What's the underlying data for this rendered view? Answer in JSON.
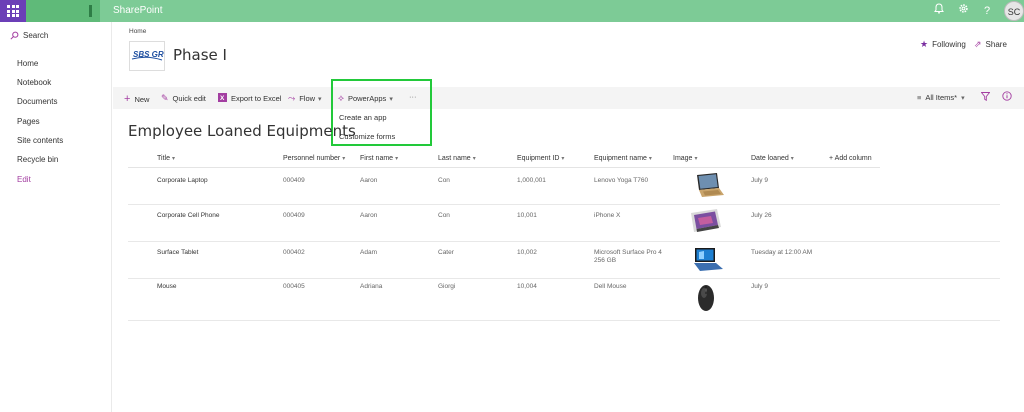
{
  "suite": {
    "title": "SharePoint",
    "avatar_initials": "SC"
  },
  "leftnav": {
    "search_label": "Search",
    "items": [
      "Home",
      "Notebook",
      "Documents",
      "Pages",
      "Site contents",
      "Recycle bin",
      "Edit"
    ]
  },
  "site": {
    "breadcrumb": "Home",
    "logo_text": "SBS GROUP",
    "title": "Phase I",
    "following_label": "Following",
    "share_label": "Share"
  },
  "commandbar": {
    "new_label": "New",
    "quick_edit_label": "Quick edit",
    "export_label": "Export to Excel",
    "flow_label": "Flow",
    "powerapps_label": "PowerApps",
    "more_label": "···",
    "powerapps_menu": [
      "Create an app",
      "Customize forms"
    ],
    "view_label": "All Items*"
  },
  "list": {
    "title": "Employee Loaned Equipments",
    "columns": [
      "Title",
      "Personnel number",
      "First name",
      "Last name",
      "Equipment ID",
      "Equipment name",
      "Image",
      "Date loaned"
    ],
    "add_column_label": "+ Add column",
    "rows": [
      {
        "title": "Corporate Laptop",
        "personnel": "000409",
        "first": "Aaron",
        "last": "Con",
        "equip_id": "1,000,001",
        "equip_name": "Lenovo Yoga T760",
        "image": "laptop",
        "date": "July 9"
      },
      {
        "title": "Corporate Cell Phone",
        "personnel": "000409",
        "first": "Aaron",
        "last": "Con",
        "equip_id": "10,001",
        "equip_name": "iPhone X",
        "image": "phone",
        "date": "July 26"
      },
      {
        "title": "Surface Tablet",
        "personnel": "000402",
        "first": "Adam",
        "last": "Cater",
        "equip_id": "10,002",
        "equip_name": "Microsoft Surface Pro 4 256 GB",
        "image": "tablet",
        "date": "Tuesday at 12:00 AM"
      },
      {
        "title": "Mouse",
        "personnel": "000405",
        "first": "Adriana",
        "last": "Giorgi",
        "equip_id": "10,004",
        "equip_name": "Dell Mouse",
        "image": "mouse",
        "date": "July 9"
      }
    ]
  },
  "colors": {
    "suite_bar": "#7dcb96",
    "waffle": "#6b3fb7",
    "accent": "#a33ea1",
    "highlight_box": "#22c93a"
  }
}
